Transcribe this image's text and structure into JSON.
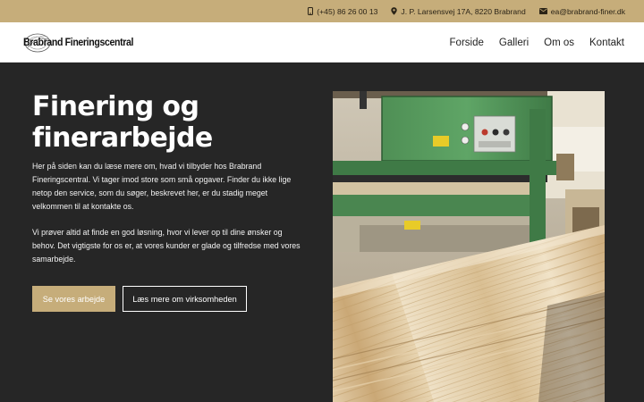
{
  "topbar": {
    "phone": "(+45) 86 26 00 13",
    "address": "J. P. Larsensvej 17A, 8220 Brabrand",
    "email": "ea@brabrand-finer.dk",
    "icons": [
      "phone-icon",
      "map-pin-icon",
      "envelope-icon"
    ]
  },
  "nav": {
    "logo_text": "Brabrand Fineringscentral",
    "items": [
      "Forside",
      "Galleri",
      "Om os",
      "Kontakt"
    ]
  },
  "hero": {
    "title_line1": "Finering og",
    "title_line2": "finerarbejde",
    "paragraph1": "Her på siden kan du læse mere om, hvad vi tilbyder hos Brabrand Fineringscentral. Vi tager imod store som små opgaver. Finder du ikke lige netop den service, som du søger, beskrevet her, er du stadig meget velkommen til at kontakte os.",
    "paragraph2": "Vi prøver altid at finde en god løsning, hvor vi lever op til dine ønsker og behov. Det vigtigste for os er, at vores kunder er glade og tilfredse med vores samarbejde.",
    "button_primary": "Se vores arbejde",
    "button_secondary": "Læs mere om virksomheden"
  },
  "colors": {
    "accent": "#c6ad7a",
    "background": "#262626",
    "nav_bg": "#ffffff"
  }
}
